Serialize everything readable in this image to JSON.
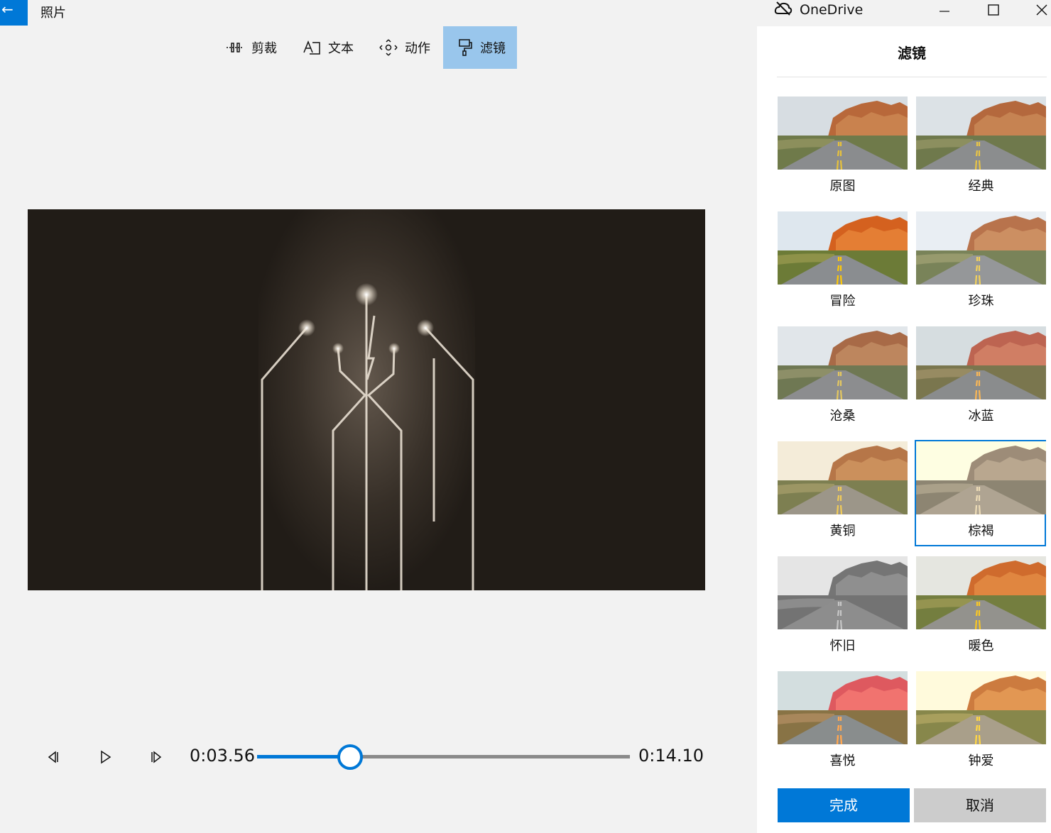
{
  "app": {
    "back_icon": "back-arrow-icon",
    "title": "照片",
    "onedrive_label": "OneDrive"
  },
  "toolbar": {
    "items": [
      {
        "label": "剪裁",
        "icon": "trim-icon",
        "active": false
      },
      {
        "label": "文本",
        "icon": "text-icon",
        "active": false
      },
      {
        "label": "动作",
        "icon": "motion-icon",
        "active": false
      },
      {
        "label": "滤镜",
        "icon": "filter-icon",
        "active": true
      }
    ]
  },
  "playback": {
    "current_time": "0:03.56",
    "total_time": "0:14.10",
    "progress": 0.25
  },
  "filters_panel": {
    "title": "滤镜",
    "items": [
      {
        "label": "原图",
        "selected": false
      },
      {
        "label": "经典",
        "selected": false
      },
      {
        "label": "冒险",
        "selected": false
      },
      {
        "label": "珍珠",
        "selected": false
      },
      {
        "label": "沧桑",
        "selected": false
      },
      {
        "label": "冰蓝",
        "selected": false
      },
      {
        "label": "黄铜",
        "selected": false
      },
      {
        "label": "棕褐",
        "selected": true
      },
      {
        "label": "怀旧",
        "selected": false
      },
      {
        "label": "暖色",
        "selected": false
      },
      {
        "label": "喜悦",
        "selected": false
      },
      {
        "label": "钟爱",
        "selected": false
      }
    ],
    "done_label": "完成",
    "cancel_label": "取消"
  },
  "colors": {
    "accent": "#0078d7",
    "active_tool": "#99c6ec",
    "preview_bg": "#211c17"
  }
}
